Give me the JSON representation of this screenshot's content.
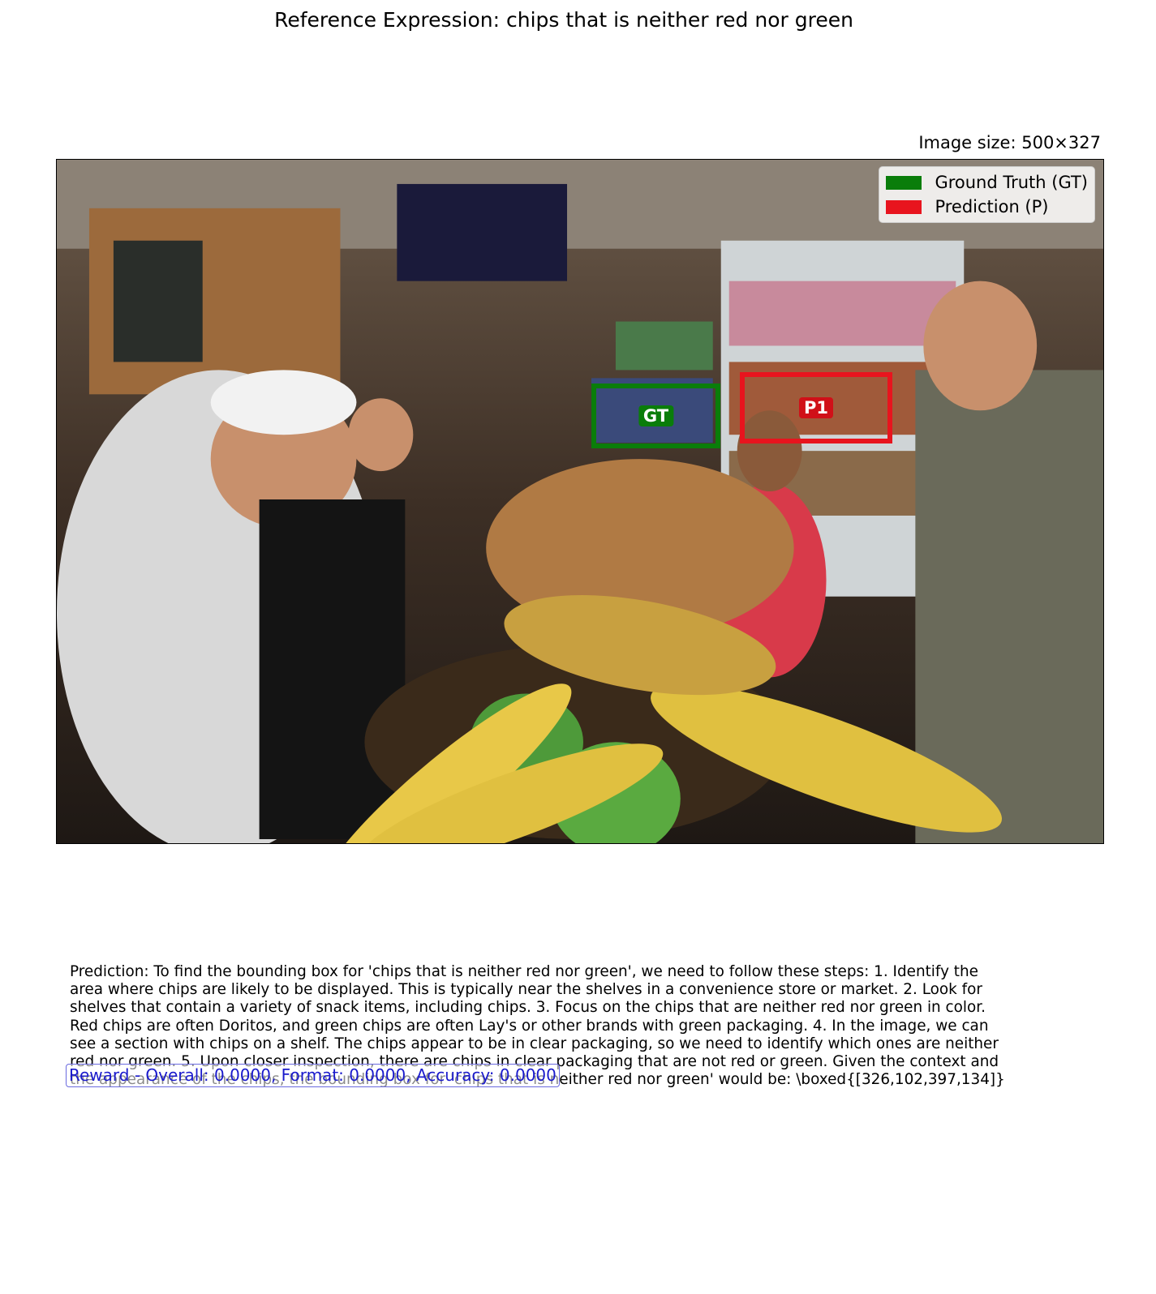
{
  "title": "Reference Expression: chips that is neither red nor green",
  "image_size_label": "Image size: 500×327",
  "legend": {
    "ground_truth": {
      "label": "Ground Truth (GT)",
      "color": "#0a7d0a"
    },
    "prediction": {
      "label": "Prediction (P)",
      "color": "#e8141e"
    }
  },
  "boxes": {
    "gt_label": "GT",
    "pred_label": "P1"
  },
  "prediction_text": "Prediction: To find the bounding box for 'chips that is neither red nor green', we need to follow these steps:  1. Identify the area where chips are likely to be displayed. This is typically near the shelves in a convenience store or market. 2. Look for shelves that contain a variety of snack items, including chips. 3. Focus on the chips that are neither red nor green in color. Red chips are often Doritos, and green chips are often Lay's or other brands with green packaging. 4. In the image, we can see a section with chips on a shelf. The chips appear to be in clear packaging, so we need to identify which ones are neither red nor green. 5. Upon closer inspection, there are chips in clear packaging that are not red or green.  Given the context and the appearance of the chips, the bounding box for 'chips that is neither red nor green' would be:  \\boxed{[326,102,397,134]}",
  "reward_text": "Reward - Overall: 0.0000, Format: 0.0000, Accuracy: 0.0000"
}
